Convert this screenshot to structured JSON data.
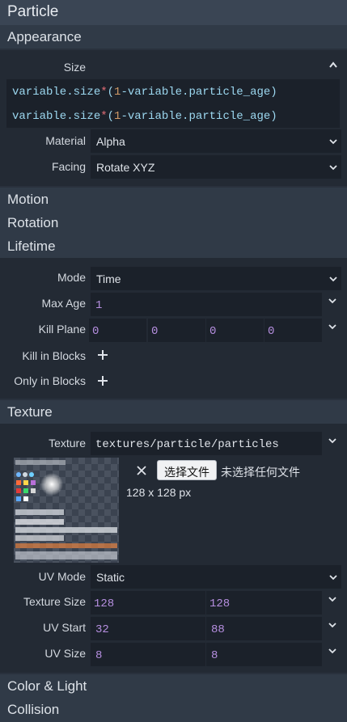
{
  "title": "Particle",
  "sections": {
    "appearance": "Appearance",
    "motion": "Motion",
    "rotation": "Rotation",
    "lifetime": "Lifetime",
    "texture": "Texture",
    "color_light": "Color & Light",
    "collision": "Collision"
  },
  "appearance": {
    "size_label": "Size",
    "size_expr_1": "variable.size*(1-variable.particle_age)",
    "size_expr_2": "variable.size*(1-variable.particle_age)",
    "material_label": "Material",
    "material_value": "Alpha",
    "facing_label": "Facing",
    "facing_value": "Rotate XYZ"
  },
  "lifetime": {
    "mode_label": "Mode",
    "mode_value": "Time",
    "max_age_label": "Max Age",
    "max_age_value": "1",
    "kill_plane_label": "Kill Plane",
    "kill_plane_values": [
      "0",
      "0",
      "0",
      "0"
    ],
    "kill_in_blocks_label": "Kill in Blocks",
    "only_in_blocks_label": "Only in Blocks"
  },
  "texture": {
    "texture_label": "Texture",
    "texture_value": "textures/particle/particles",
    "choose_file_button": "选择文件",
    "no_file_text": "未选择任何文件",
    "dimensions_text": "128 x 128 px",
    "uv_mode_label": "UV Mode",
    "uv_mode_value": "Static",
    "texture_size_label": "Texture Size",
    "texture_size_values": [
      "128",
      "128"
    ],
    "uv_start_label": "UV Start",
    "uv_start_values": [
      "32",
      "88"
    ],
    "uv_size_label": "UV Size",
    "uv_size_values": [
      "8",
      "8"
    ]
  },
  "icons": {
    "collapse": "chevron-up-icon",
    "dropdown": "chevron-down-icon",
    "add": "plus-icon",
    "clear": "close-icon"
  },
  "colors": {
    "accent_number": "#b68fe0",
    "background": "#29313d",
    "panel": "#232a34",
    "field": "#1b212a"
  }
}
